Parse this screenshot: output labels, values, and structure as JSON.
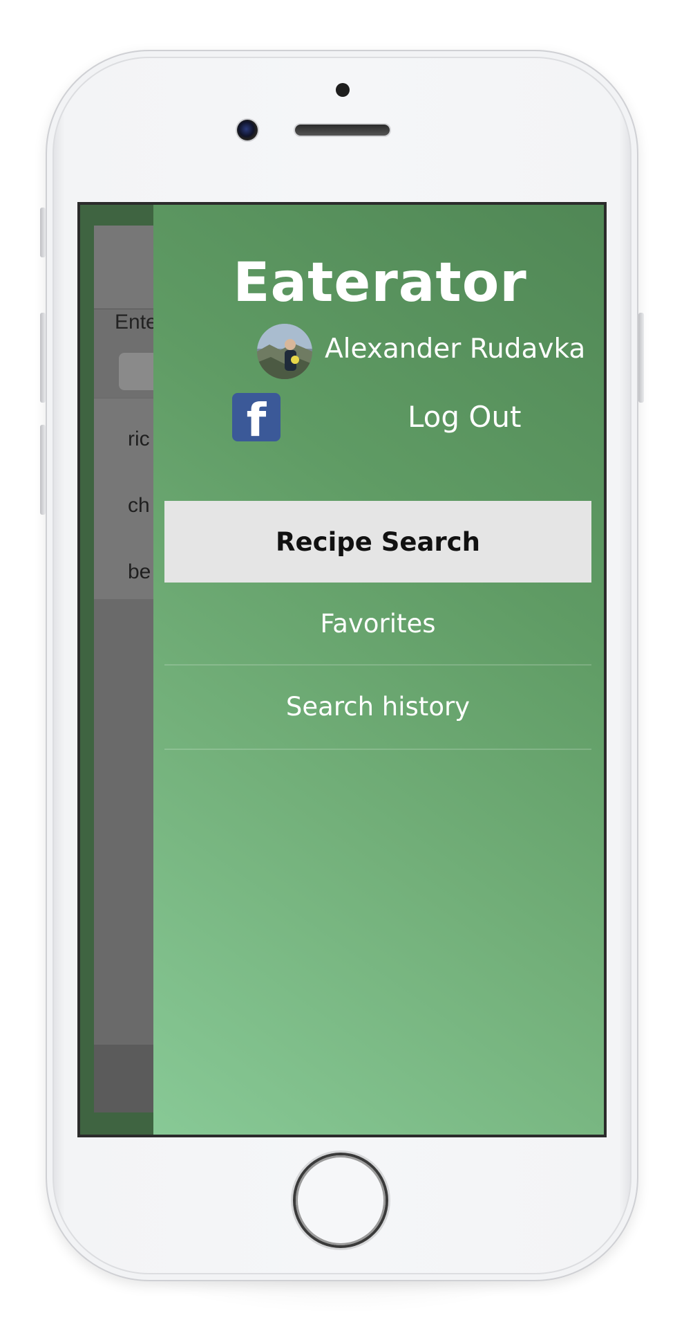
{
  "background_app": {
    "prompt_text": "Ente",
    "rows": [
      "ric",
      "ch",
      "be"
    ]
  },
  "drawer": {
    "app_title": "Eaterator",
    "user": {
      "name": "Alexander Rudavka"
    },
    "facebook_icon_glyph": "f",
    "logout_label": "Log Out",
    "menu": [
      {
        "label": "Recipe Search",
        "active": true
      },
      {
        "label": "Favorites",
        "active": false
      },
      {
        "label": "Search history",
        "active": false
      }
    ]
  },
  "colors": {
    "drawer_gradient_start": "#508755",
    "drawer_gradient_end": "#88c996",
    "active_item_bg": "#e5e5e5",
    "facebook_blue": "#3b5998"
  },
  "icons": [
    "facebook-icon",
    "user-avatar"
  ]
}
